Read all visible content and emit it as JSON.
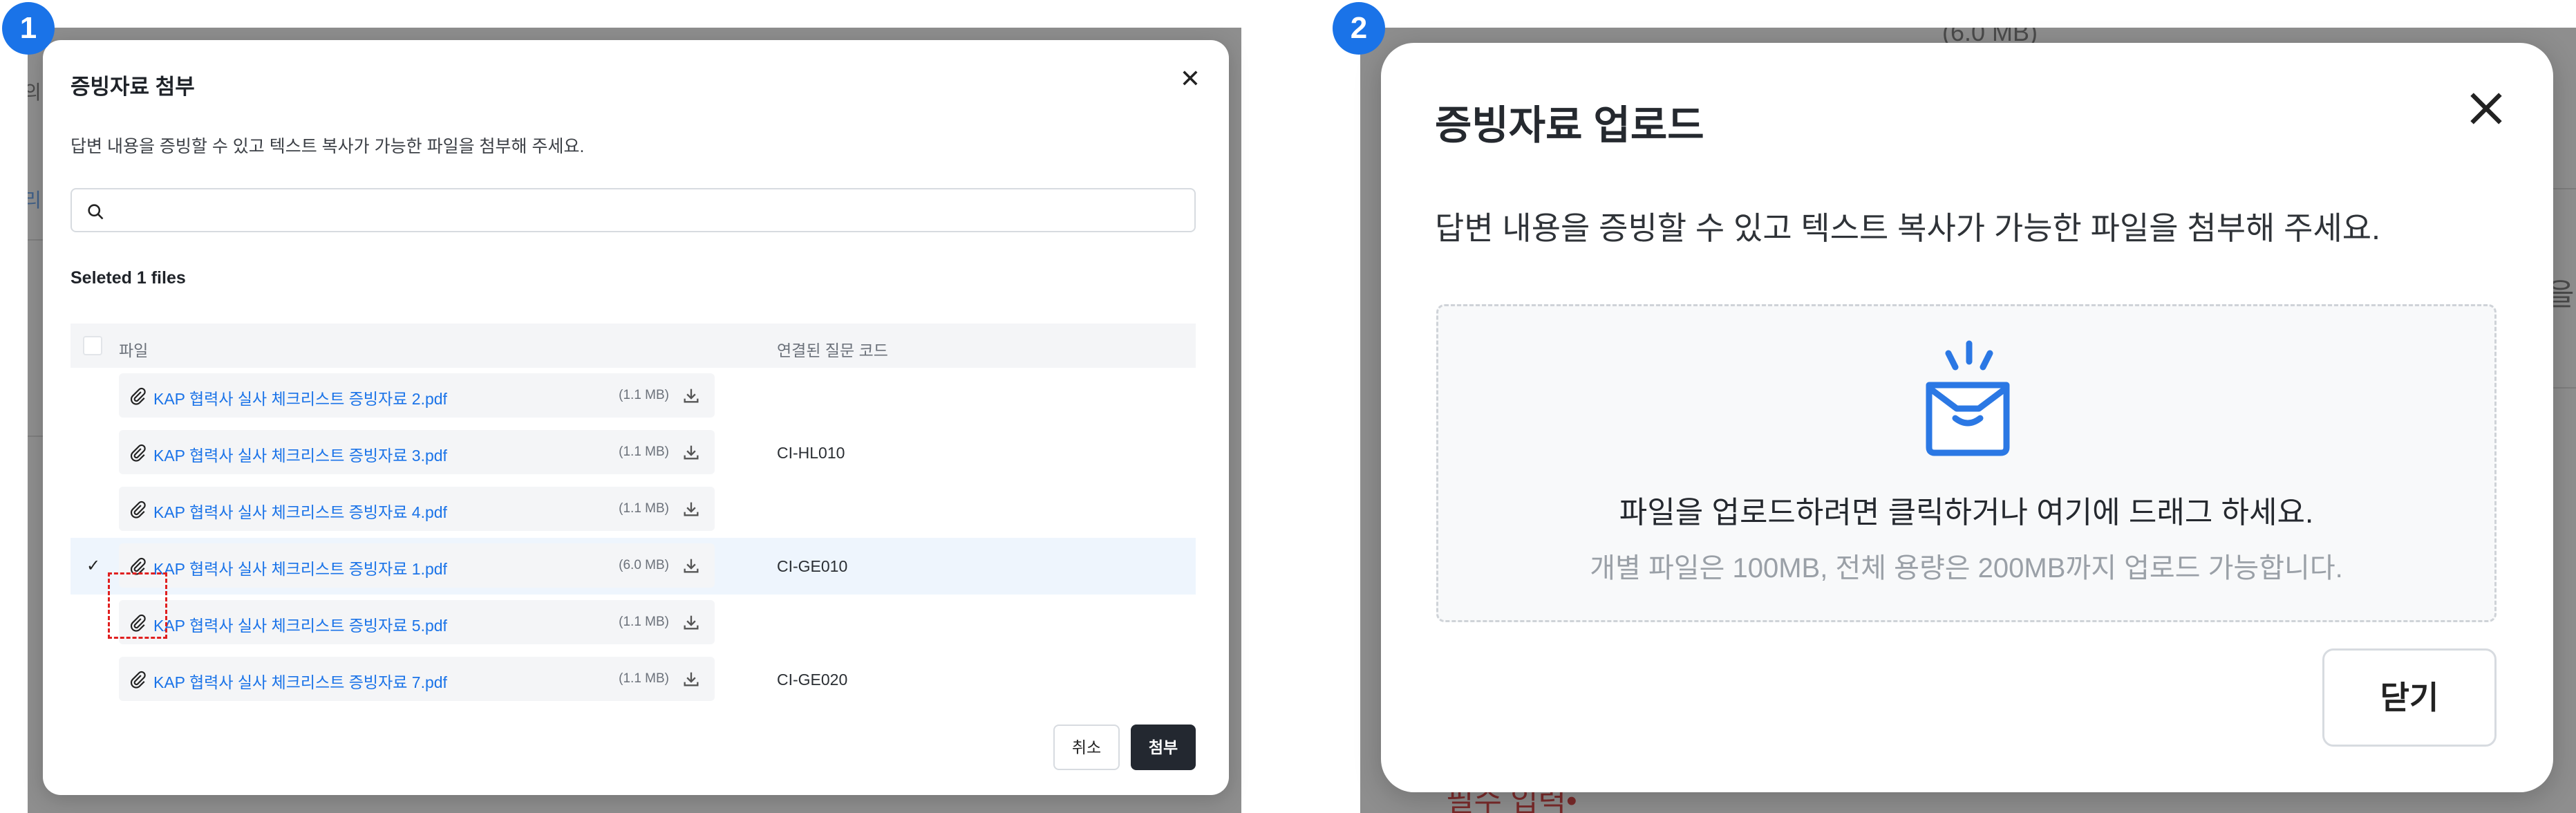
{
  "badges": {
    "first": "1",
    "second": "2"
  },
  "background": {
    "left_fragment_1": "의",
    "left_fragment_2": "리",
    "right_size_text": "(6.0 MB)",
    "right_side_fragment": "을",
    "bottom_text": "필수 입력•"
  },
  "modal1": {
    "title": "증빙자료 첨부",
    "description": "답변 내용을 증빙할 수 있고 텍스트 복사가 가능한 파일을 첨부해 주세요.",
    "search_placeholder": "",
    "selected_label": "Seleted 1 files",
    "columns": {
      "file": "파일",
      "code": "연결된 질문 코드"
    },
    "rows": [
      {
        "name": "KAP 협력사 실사 체크리스트 증빙자료 2.pdf",
        "size": "(1.1 MB)",
        "code": "",
        "checked": false
      },
      {
        "name": "KAP 협력사 실사 체크리스트 증빙자료 3.pdf",
        "size": "(1.1 MB)",
        "code": "CI-HL010",
        "checked": false
      },
      {
        "name": "KAP 협력사 실사 체크리스트 증빙자료 4.pdf",
        "size": "(1.1 MB)",
        "code": "",
        "checked": false
      },
      {
        "name": "KAP 협력사 실사 체크리스트 증빙자료 1.pdf",
        "size": "(6.0 MB)",
        "code": "CI-GE010",
        "checked": true
      },
      {
        "name": "KAP 협력사 실사 체크리스트 증빙자료 5.pdf",
        "size": "(1.1 MB)",
        "code": "",
        "checked": false
      },
      {
        "name": "KAP 협력사 실사 체크리스트 증빙자료 7.pdf",
        "size": "(1.1 MB)",
        "code": "CI-GE020",
        "checked": false
      }
    ],
    "cancel_label": "취소",
    "attach_label": "첨부"
  },
  "modal2": {
    "title": "증빙자료 업로드",
    "description": "답변 내용을 증빙할 수 있고 텍스트 복사가 가능한 파일을 첨부해 주세요.",
    "dropzone_main": "파일을 업로드하려면 클릭하거나 여기에 드래그 하세요.",
    "dropzone_sub": "개별 파일은 100MB, 전체 용량은 200MB까지 업로드 가능합니다.",
    "close_label": "닫기"
  },
  "colors": {
    "accent": "#1a73e8",
    "primary_button": "#232830",
    "highlight": "#e02020",
    "selected_row": "#eef5fd"
  },
  "icons": [
    "search-icon",
    "close-icon",
    "paperclip-icon",
    "download-icon",
    "check-icon",
    "inbox-upload-icon"
  ]
}
